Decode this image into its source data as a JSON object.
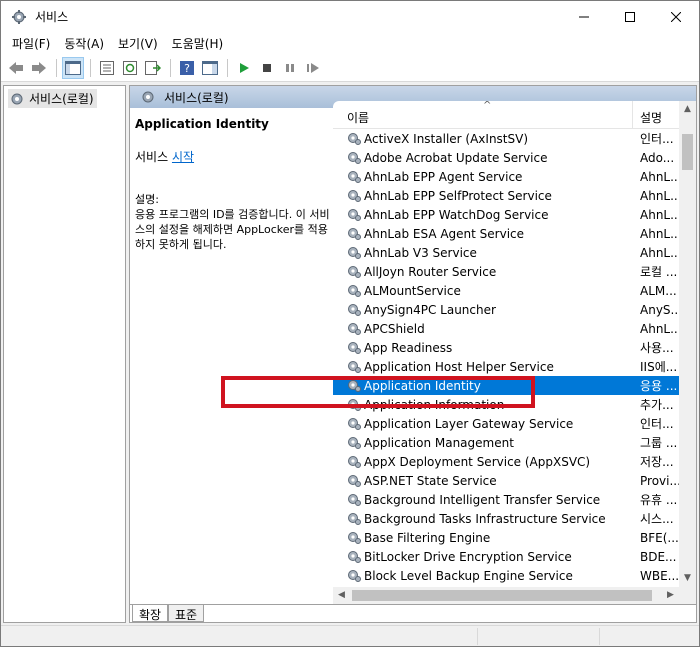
{
  "window": {
    "title": "서비스",
    "accent": "#0078d7"
  },
  "menu": [
    "파일(F)",
    "동작(A)",
    "보기(V)",
    "도움말(H)"
  ],
  "tree": {
    "root_label": "서비스(로컬)"
  },
  "content": {
    "header_label": "서비스(로컬)",
    "selected_service": "Application Identity",
    "action_prefix": "서비스",
    "action_link": "시작",
    "desc_label": "설명:",
    "desc_text": "응용 프로그램의 ID를 검증합니다. 이 서비스의 설정을 해제하면 AppLocker를 적용하지 못하게 됩니다."
  },
  "list": {
    "columns": {
      "name": "이름",
      "description": "설명"
    },
    "rows": [
      {
        "name": "ActiveX Installer (AxInstSV)",
        "desc": "인터..."
      },
      {
        "name": "Adobe Acrobat Update Service",
        "desc": "Ado..."
      },
      {
        "name": "AhnLab EPP Agent Service",
        "desc": "AhnL..."
      },
      {
        "name": "AhnLab EPP SelfProtect Service",
        "desc": "AhnL..."
      },
      {
        "name": "AhnLab EPP WatchDog Service",
        "desc": "AhnL..."
      },
      {
        "name": "AhnLab ESA Agent Service",
        "desc": "AhnL..."
      },
      {
        "name": "AhnLab V3 Service",
        "desc": "AhnL..."
      },
      {
        "name": "AllJoyn Router Service",
        "desc": "로컬 ..."
      },
      {
        "name": "ALMountService",
        "desc": "ALM..."
      },
      {
        "name": "AnySign4PC Launcher",
        "desc": "AnyS..."
      },
      {
        "name": "APCShield",
        "desc": "AhnL..."
      },
      {
        "name": "App Readiness",
        "desc": "사용..."
      },
      {
        "name": "Application Host Helper Service",
        "desc": "IIS에..."
      },
      {
        "name": "Application Identity",
        "desc": "응용 ..."
      },
      {
        "name": "Application Information",
        "desc": "추가..."
      },
      {
        "name": "Application Layer Gateway Service",
        "desc": "인터..."
      },
      {
        "name": "Application Management",
        "desc": "그룹 ..."
      },
      {
        "name": "AppX Deployment Service (AppXSVC)",
        "desc": "저장..."
      },
      {
        "name": "ASP.NET State Service",
        "desc": "Provi..."
      },
      {
        "name": "Background Intelligent Transfer Service",
        "desc": "유휴 ..."
      },
      {
        "name": "Background Tasks Infrastructure Service",
        "desc": "시스..."
      },
      {
        "name": "Base Filtering Engine",
        "desc": "BFE(..."
      },
      {
        "name": "BitLocker Drive Encryption Service",
        "desc": "BDE..."
      },
      {
        "name": "Block Level Backup Engine Service",
        "desc": "WBE..."
      }
    ],
    "selected_index": 13
  },
  "tabs": [
    "확장",
    "표준"
  ],
  "colors": {
    "highlight_box": "#d0131f",
    "selection": "#0078d7"
  }
}
